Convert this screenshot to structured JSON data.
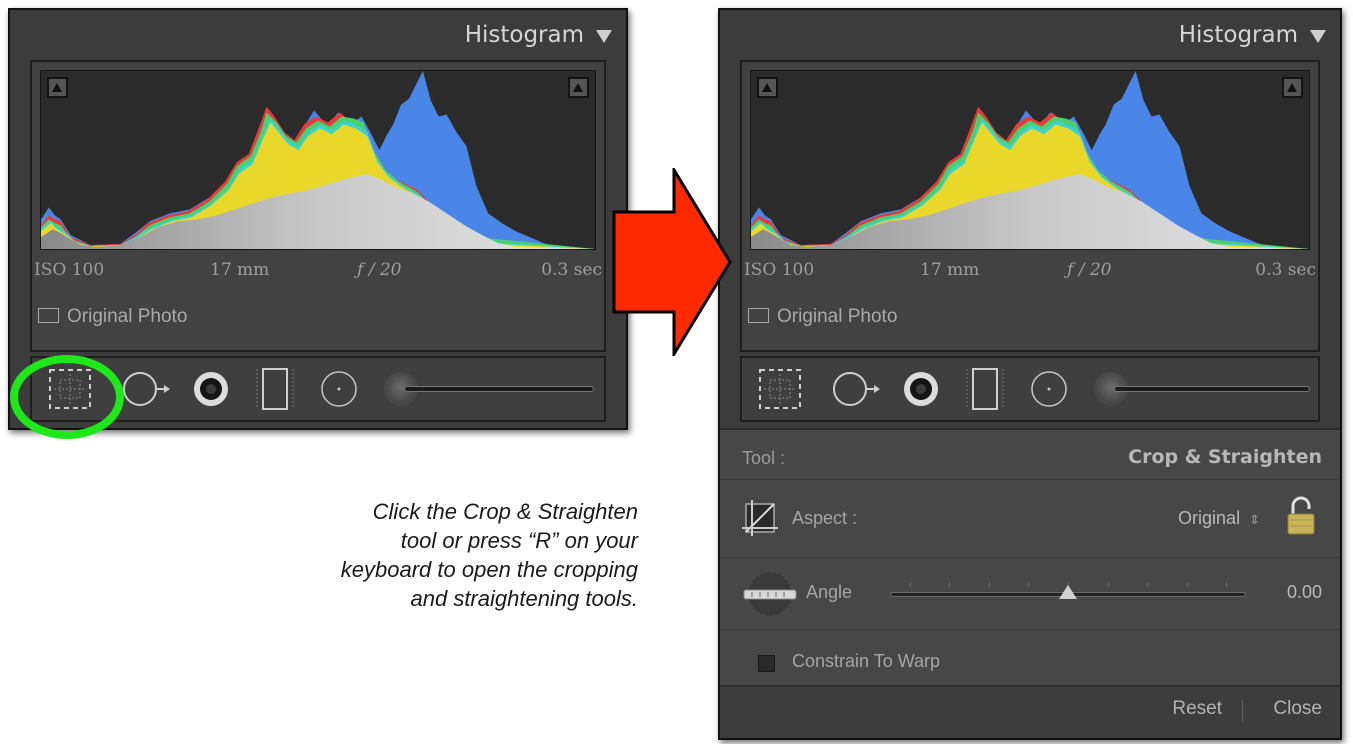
{
  "left_panel": {
    "histogram": {
      "title": "Histogram",
      "exif": {
        "iso": "ISO 100",
        "focal": "17 mm",
        "aperture": "ƒ / 20",
        "shutter": "0.3 sec"
      },
      "original_photo_label": "Original Photo"
    }
  },
  "right_panel": {
    "histogram": {
      "title": "Histogram",
      "exif": {
        "iso": "ISO 100",
        "focal": "17 mm",
        "aperture": "ƒ / 20",
        "shutter": "0.3 sec"
      },
      "original_photo_label": "Original Photo"
    },
    "crop_panel": {
      "tool_label": "Tool :",
      "tool_value": "Crop & Straighten",
      "aspect_label": "Aspect :",
      "aspect_value": "Original",
      "aspect_chevron": "⇕",
      "angle_label": "Angle",
      "angle_value": "0.00",
      "angle_position": 0.5,
      "constrain_label": "Constrain To Warp",
      "constrain_checked": false,
      "reset_label": "Reset",
      "close_label": "Close"
    }
  },
  "caption": {
    "lines": [
      "Click the Crop & Straighten",
      "tool or press “R” on your",
      "keyboard to open the cropping",
      "and straightening tools."
    ]
  },
  "annotations": {
    "highlight_color": "#1ee81a",
    "arrow_color": "#ff2a00"
  },
  "icons": [
    "crop-icon",
    "spot-removal-icon",
    "red-eye-icon",
    "graduated-filter-icon",
    "radial-filter-icon",
    "adjustment-brush-icon",
    "lock-icon",
    "angle-tool-icon",
    "disclosure-triangle-icon"
  ]
}
